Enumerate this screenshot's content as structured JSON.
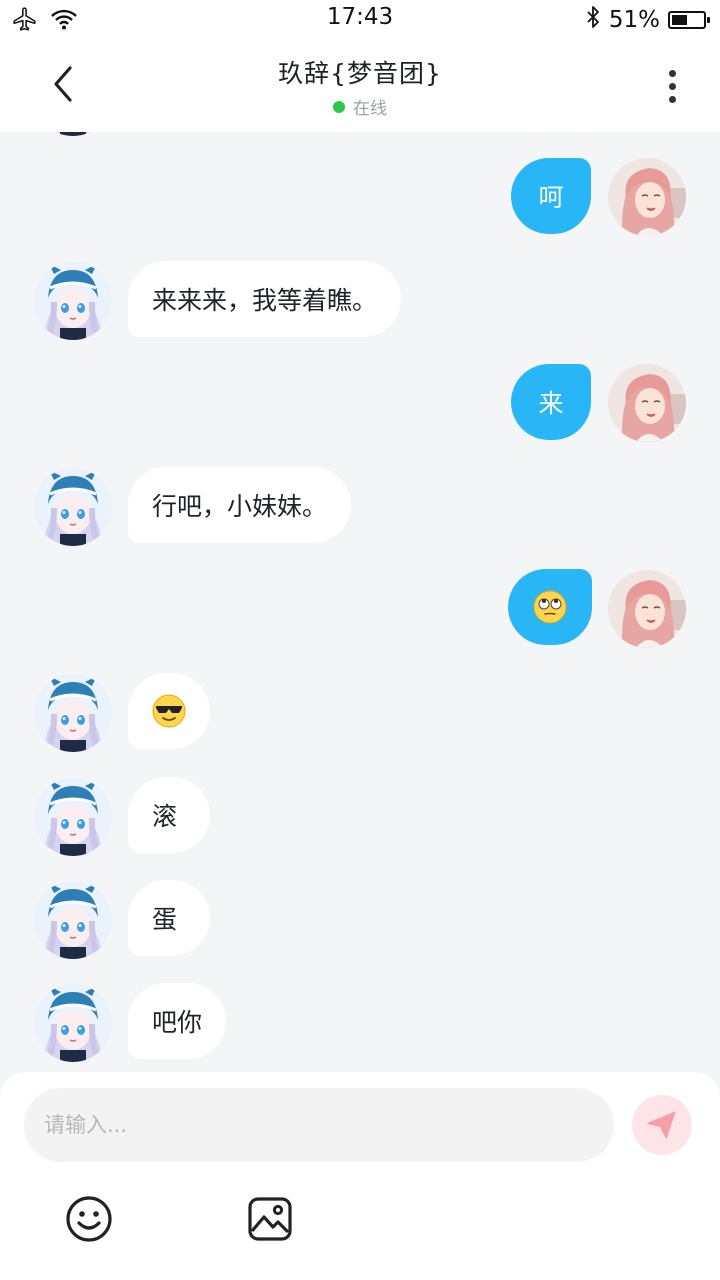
{
  "status_bar": {
    "time": "17:43",
    "battery": "51%",
    "battery_level": 0.51
  },
  "header": {
    "title": "玖辞{梦音团}",
    "status": "在线",
    "status_color": "#2ec74a"
  },
  "messages": [
    {
      "dir": "out",
      "text": "呵"
    },
    {
      "dir": "in",
      "text": "来来来，我等着瞧。"
    },
    {
      "dir": "out",
      "text": "来"
    },
    {
      "dir": "in",
      "text": "行吧，小妹妹。"
    },
    {
      "dir": "out",
      "emoji": "rolling-eyes-emoji"
    },
    {
      "dir": "in",
      "emoji": "sunglasses-emoji"
    },
    {
      "dir": "in",
      "text": "滚"
    },
    {
      "dir": "in",
      "text": "蛋"
    },
    {
      "dir": "in",
      "text": "吧你"
    }
  ],
  "input": {
    "placeholder": "请输入..."
  },
  "colors": {
    "accent": "#29b6f6",
    "send_bg": "#fde4e6",
    "send_icon": "#f5a0a8",
    "chat_bg": "#f3f5f7"
  },
  "icons": [
    "airplane-icon",
    "wifi-icon",
    "bluetooth-icon",
    "battery-icon",
    "back-arrow-icon",
    "more-vertical-icon",
    "send-icon",
    "emoji-icon",
    "image-icon"
  ]
}
